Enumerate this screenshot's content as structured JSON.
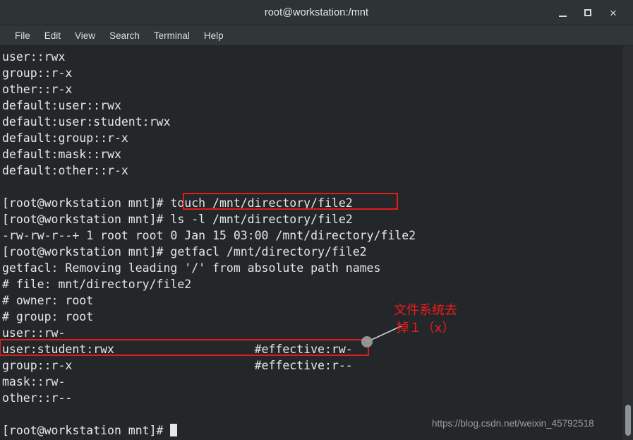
{
  "window": {
    "title": "root@workstation:/mnt",
    "controls": {
      "minimize": "–",
      "maximize": "□",
      "close": "×"
    }
  },
  "menubar": {
    "items": [
      {
        "label": "File"
      },
      {
        "label": "Edit"
      },
      {
        "label": "View"
      },
      {
        "label": "Search"
      },
      {
        "label": "Terminal"
      },
      {
        "label": "Help"
      }
    ]
  },
  "terminal": {
    "lines": [
      "user::rwx",
      "group::r-x",
      "other::r-x",
      "default:user::rwx",
      "default:user:student:rwx",
      "default:group::r-x",
      "default:mask::rwx",
      "default:other::r-x",
      "",
      "[root@workstation mnt]# touch /mnt/directory/file2",
      "[root@workstation mnt]# ls -l /mnt/directory/file2",
      "-rw-rw-r--+ 1 root root 0 Jan 15 03:00 /mnt/directory/file2",
      "[root@workstation mnt]# getfacl /mnt/directory/file2",
      "getfacl: Removing leading '/' from absolute path names",
      "# file: mnt/directory/file2",
      "# owner: root",
      "# group: root",
      "user::rw-",
      "user:student:rwx                    #effective:rw-",
      "group::r-x                          #effective:r--",
      "mask::rw-",
      "other::r--",
      "",
      ""
    ],
    "prompt": "[root@workstation mnt]# "
  },
  "annotations": {
    "highlight_color": "#e21b1b",
    "note_color": "#f01a1a",
    "note_line1": "文件系统去",
    "note_line2": "掉１（x）",
    "boxed_command": "touch /mnt/directory/file2",
    "boxed_acl_entry": "user:student:rwx                    #effective:rw-"
  },
  "watermark": {
    "text": "https://blog.csdn.net/weixin_45792518",
    "color": "#9a9fa1"
  }
}
